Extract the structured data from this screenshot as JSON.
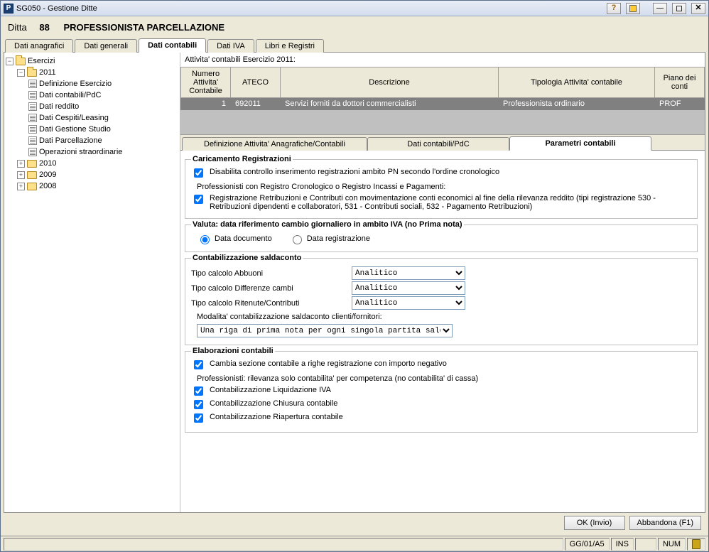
{
  "window": {
    "title": "SG050 - Gestione Ditte"
  },
  "header": {
    "label": "Ditta",
    "number": "88",
    "name": "PROFESSIONISTA PARCELLAZIONE"
  },
  "topTabs": {
    "anagrafici": "Dati anagrafici",
    "generali": "Dati generali",
    "contabili": "Dati contabili",
    "iva": "Dati IVA",
    "libri": "Libri e Registri"
  },
  "tree": {
    "root": "Esercizi",
    "y2011": "2011",
    "y2010": "2010",
    "y2009": "2009",
    "y2008": "2008",
    "items": {
      "defEs": "Definizione Esercizio",
      "contPdc": "Dati contabili/PdC",
      "reddito": "Dati reddito",
      "cespiti": "Dati Cespiti/Leasing",
      "studio": "Dati Gestione Studio",
      "parcel": "Dati Parcellazione",
      "straord": "Operazioni straordinarie"
    }
  },
  "gridTitle": "Attivita' contabili Esercizio 2011:",
  "gridHeaders": {
    "num": "Numero Attivita' Contabile",
    "ateco": "ATECO",
    "descr": "Descrizione",
    "tipologia": "Tipologia Attivita' contabile",
    "piano": "Piano dei conti"
  },
  "gridRow": {
    "num": "1",
    "ateco": "692011",
    "descr": "Servizi forniti da dottori commercialisti",
    "tipologia": "Professionista ordinario",
    "piano": "PROF"
  },
  "subTabs": {
    "def": "Definizione Attivita' Anagrafiche/Contabili",
    "pdc": "Dati contabili/PdC",
    "param": "Parametri contabili"
  },
  "groups": {
    "caricamento": "Caricamento Registrazioni",
    "valuta": "Valuta: data riferimento cambio giornaliero in ambito IVA (no Prima nota)",
    "saldaconto": "Contabilizzazione saldaconto",
    "elab": "Elaborazioni contabili"
  },
  "fields": {
    "cb_disabilita": "Disabilita controllo inserimento registrazioni ambito PN secondo l'ordine cronologico",
    "prof_reg_intro": "Professionisti con Registro Cronologico o Registro Incassi e Pagamenti:",
    "cb_retrib": "Registrazione Retribuzioni e Contributi con movimentazione conti economici al fine della rilevanza reddito (tipi registrazione 530 - Retribuzioni dipendenti e collaboratori, 531 - Contributi sociali, 532 - Pagamento Retribuzioni)",
    "rb_doc": "Data documento",
    "rb_reg": "Data registrazione",
    "lbl_abbuoni": "Tipo calcolo Abbuoni",
    "lbl_diff": "Tipo calcolo Differenze cambi",
    "lbl_rit": "Tipo calcolo Ritenute/Contributi",
    "opt_analitico": "Analitico",
    "lbl_modalita": "Modalita' contabilizzazione saldaconto clienti/fornitori:",
    "opt_modalita": "Una riga di prima nota per ogni singola partita saldata",
    "cb_cambia": "Cambia sezione contabile a righe registrazione con importo negativo",
    "prof_comp_intro": "Professionisti: rilevanza solo contabilita' per competenza (no contabilita' di cassa)",
    "cb_liq": "Contabilizzazione Liquidazione IVA",
    "cb_chiusura": "Contabilizzazione Chiusura contabile",
    "cb_riapertura": "Contabilizzazione Riapertura contabile"
  },
  "buttons": {
    "ok": "OK (Invio)",
    "abbandona": "Abbandona (F1)"
  },
  "status": {
    "date": "GG/01/A5",
    "ins": "INS",
    "num": "NUM"
  }
}
